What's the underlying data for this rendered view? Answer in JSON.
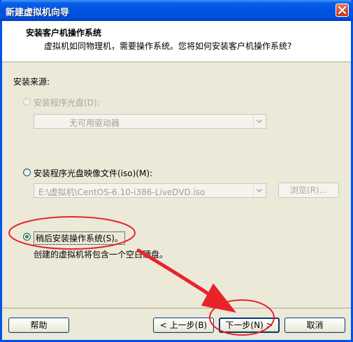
{
  "window": {
    "title": "新建虚拟机向导"
  },
  "header": {
    "title": "安装客户机操作系统",
    "subtitle": "虚拟机如同物理机，需要操作系统。您将如何安装客户机操作系统?"
  },
  "install_source": {
    "label": "安装来源:",
    "disc_option": {
      "label": "安装程序光盘(D):",
      "selected": false,
      "enabled": false
    },
    "disc_select": {
      "value": "无可用驱动器"
    },
    "iso_option": {
      "label": "安装程序光盘映像文件(iso)(M):",
      "selected": false,
      "enabled": true
    },
    "iso_select": {
      "value": "E:\\虚拟机\\CentOS-6.10-i386-LiveDVD.iso"
    },
    "browse_label": "浏览(R)...",
    "later_option": {
      "label": "稍后安装操作系统(S)。",
      "selected": true,
      "enabled": true
    },
    "later_description": "创建的虚拟机将包含一个空白硬盘。"
  },
  "footer": {
    "help": "帮助",
    "back": "< 上一步(B)",
    "next": "下一步(N) >",
    "cancel": "取消"
  },
  "colors": {
    "annotation": "#e8232a",
    "titlebar": "#0054e3"
  },
  "icons": [
    "close-icon",
    "chevron-down-icon"
  ]
}
